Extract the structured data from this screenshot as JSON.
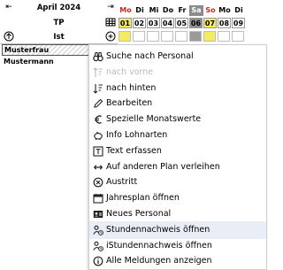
{
  "header": {
    "month": "April 2024",
    "row2_label": "TP",
    "row3_label": "Ist"
  },
  "persons": [
    "Musterfrau",
    "Mustermann"
  ],
  "days": [
    {
      "name": "Mo",
      "num": "01",
      "name_bg": "#ffffff",
      "name_color": "#e02020",
      "num_bg": "#f4ec5e",
      "cell_bg": "#f4ec5e"
    },
    {
      "name": "Di",
      "num": "02",
      "name_bg": "#ffffff",
      "name_color": "#000000",
      "num_bg": "#ffffff",
      "cell_bg": "#ffffff"
    },
    {
      "name": "Mi",
      "num": "03",
      "name_bg": "#ffffff",
      "name_color": "#000000",
      "num_bg": "#ffffff",
      "cell_bg": "#ffffff"
    },
    {
      "name": "Do",
      "num": "04",
      "name_bg": "#ffffff",
      "name_color": "#000000",
      "num_bg": "#ffffff",
      "cell_bg": "#ffffff"
    },
    {
      "name": "Fr",
      "num": "05",
      "name_bg": "#ffffff",
      "name_color": "#000000",
      "num_bg": "#ffffff",
      "cell_bg": "#ffffff"
    },
    {
      "name": "Sa",
      "num": "06",
      "name_bg": "#8c8c8c",
      "name_color": "#ffffff",
      "num_bg": "#8c8c8c",
      "cell_bg": "#9a9a9a"
    },
    {
      "name": "So",
      "num": "07",
      "name_bg": "#ffffff",
      "name_color": "#e02020",
      "num_bg": "#f4ec5e",
      "cell_bg": "#f4ec5e"
    },
    {
      "name": "Mo",
      "num": "08",
      "name_bg": "#ffffff",
      "name_color": "#000000",
      "num_bg": "#ffffff",
      "cell_bg": "#ffffff"
    },
    {
      "name": "Di",
      "num": "09",
      "name_bg": "#ffffff",
      "name_color": "#000000",
      "num_bg": "#ffffff",
      "cell_bg": "#ffffff"
    }
  ],
  "menu": {
    "items": [
      {
        "icon": "binoculars-icon",
        "label": "Suche nach Personal",
        "enabled": true
      },
      {
        "icon": "sort-up-icon",
        "label": "nach vorne",
        "enabled": false
      },
      {
        "icon": "sort-down-icon",
        "label": "nach hinten",
        "enabled": true
      },
      {
        "icon": "pencil-icon",
        "label": "Bearbeiten",
        "enabled": true
      },
      {
        "icon": "euro-icon",
        "label": "Spezielle Monatswerte",
        "enabled": true
      },
      {
        "icon": "piggy-bank-icon",
        "label": "Info Lohnarten",
        "enabled": true
      },
      {
        "icon": "text-icon",
        "label": "Text erfassen",
        "enabled": true
      },
      {
        "icon": "transfer-icon",
        "label": "Auf anderen Plan verleihen",
        "enabled": true
      },
      {
        "icon": "cancel-circle-icon",
        "label": "Austritt",
        "enabled": true
      },
      {
        "icon": "calendar-icon",
        "label": "Jahresplan öffnen",
        "enabled": true
      },
      {
        "icon": "id-card-icon",
        "label": "Neues Personal",
        "enabled": true
      },
      {
        "icon": "user-clock-icon",
        "label": "Stundennachweis öffnen",
        "enabled": true,
        "hover": true
      },
      {
        "icon": "user-clock-icon",
        "label": "iStundennachweis öffnen",
        "enabled": true
      },
      {
        "icon": "info-circle-icon",
        "label": "Alle Meldungen anzeigen",
        "enabled": true
      }
    ]
  }
}
